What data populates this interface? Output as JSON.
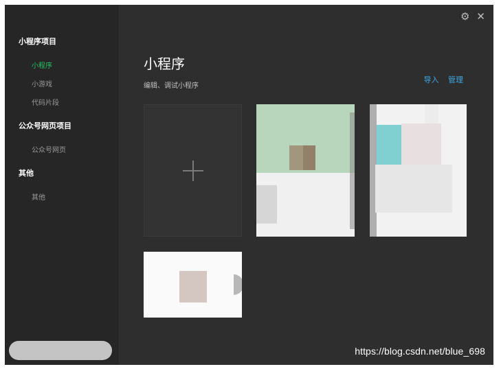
{
  "sidebar": {
    "groups": [
      {
        "label": "小程序项目",
        "items": [
          {
            "label": "小程序",
            "active": true
          },
          {
            "label": "小游戏",
            "active": false
          },
          {
            "label": "代码片段",
            "active": false
          }
        ]
      },
      {
        "label": "公众号网页项目",
        "items": [
          {
            "label": "公众号网页",
            "active": false
          }
        ]
      },
      {
        "label": "其他",
        "items": [
          {
            "label": "其他",
            "active": false
          }
        ]
      }
    ]
  },
  "header": {
    "title": "小程序",
    "subtitle": "编辑、调试小程序",
    "actions": {
      "import_label": "导入",
      "manage_label": "管理"
    }
  },
  "window_controls": {
    "settings_icon": "gear-icon",
    "close_icon": "close-icon"
  },
  "watermark": {
    "text": "https://blog.csdn.net/blue_698"
  }
}
